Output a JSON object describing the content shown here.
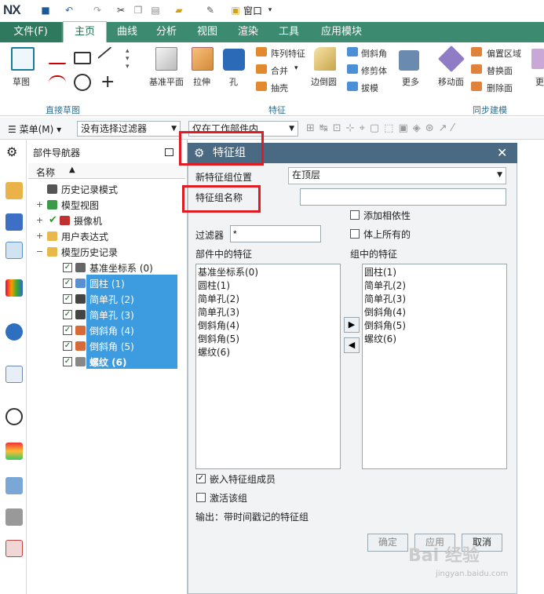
{
  "app": {
    "logo": "NX",
    "window_menu": "窗口"
  },
  "tabs": [
    "文件(F)",
    "主页",
    "曲线",
    "分析",
    "视图",
    "渲染",
    "工具",
    "应用模块"
  ],
  "ribbon": {
    "sketch": "草图",
    "group_direct_sketch": "直接草图",
    "datum_plane": "基准平面",
    "extrude": "拉伸",
    "hole": "孔",
    "pattern_feature": "阵列特征",
    "unite": "合并",
    "shell": "抽壳",
    "edge_blend": "边倒圆",
    "chamfer": "倒斜角",
    "trim_body": "修剪体",
    "draft": "拔模",
    "more": "更多",
    "group_feature": "特征",
    "move_face": "移动面",
    "offset_region": "偏置区域",
    "replace_face": "替换面",
    "delete_face": "删除面",
    "more2": "更",
    "group_sync": "同步建模"
  },
  "cmdbar": {
    "menu": "菜单(M)",
    "filter": "没有选择过滤器",
    "scope": "仅在工作部件内"
  },
  "navigator": {
    "title": "部件导航器",
    "col_name": "名称",
    "tree": [
      {
        "label": "历史记录模式",
        "icon": "clock-icon"
      },
      {
        "label": "模型视图",
        "icon": "model-view-icon"
      },
      {
        "label": "摄像机",
        "icon": "camera-icon"
      },
      {
        "label": "用户表达式",
        "icon": "folder-icon"
      },
      {
        "label": "模型历史记录",
        "icon": "folder-icon"
      },
      {
        "label": "基准坐标系 (0)",
        "icon": "csys-icon"
      },
      {
        "label": "圆柱 (1)",
        "icon": "cylinder-icon"
      },
      {
        "label": "简单孔 (2)",
        "icon": "hole-icon"
      },
      {
        "label": "简单孔 (3)",
        "icon": "hole-icon"
      },
      {
        "label": "倒斜角 (4)",
        "icon": "chamfer-icon"
      },
      {
        "label": "倒斜角 (5)",
        "icon": "chamfer-icon"
      },
      {
        "label": "螺纹 (6)",
        "icon": "thread-icon"
      }
    ]
  },
  "dialog": {
    "title": "特征组",
    "location_label": "新特征组位置",
    "location_value": "在顶层",
    "name_label": "特征组名称",
    "name_value": "",
    "add_dependencies": "添加相依性",
    "all_in_body": "体上所有的",
    "filter_label": "过滤器",
    "filter_value": "*",
    "part_features_label": "部件中的特征",
    "group_features_label": "组中的特征",
    "part_features": [
      "基准坐标系(0)",
      "圆柱(1)",
      "简单孔(2)",
      "简单孔(3)",
      "倒斜角(4)",
      "倒斜角(5)",
      "螺纹(6)"
    ],
    "group_features": [
      "圆柱(1)",
      "简单孔(2)",
      "简单孔(3)",
      "倒斜角(4)",
      "倒斜角(5)",
      "螺纹(6)"
    ],
    "embed_members": "嵌入特征组成员",
    "activate_group": "激活该组",
    "output": "输出：带时间戳记的特征组",
    "ok": "确定",
    "apply": "应用",
    "cancel": "取消"
  },
  "watermark": {
    "main": "Bai 经验",
    "sub": "jingyan.baidu.com"
  }
}
